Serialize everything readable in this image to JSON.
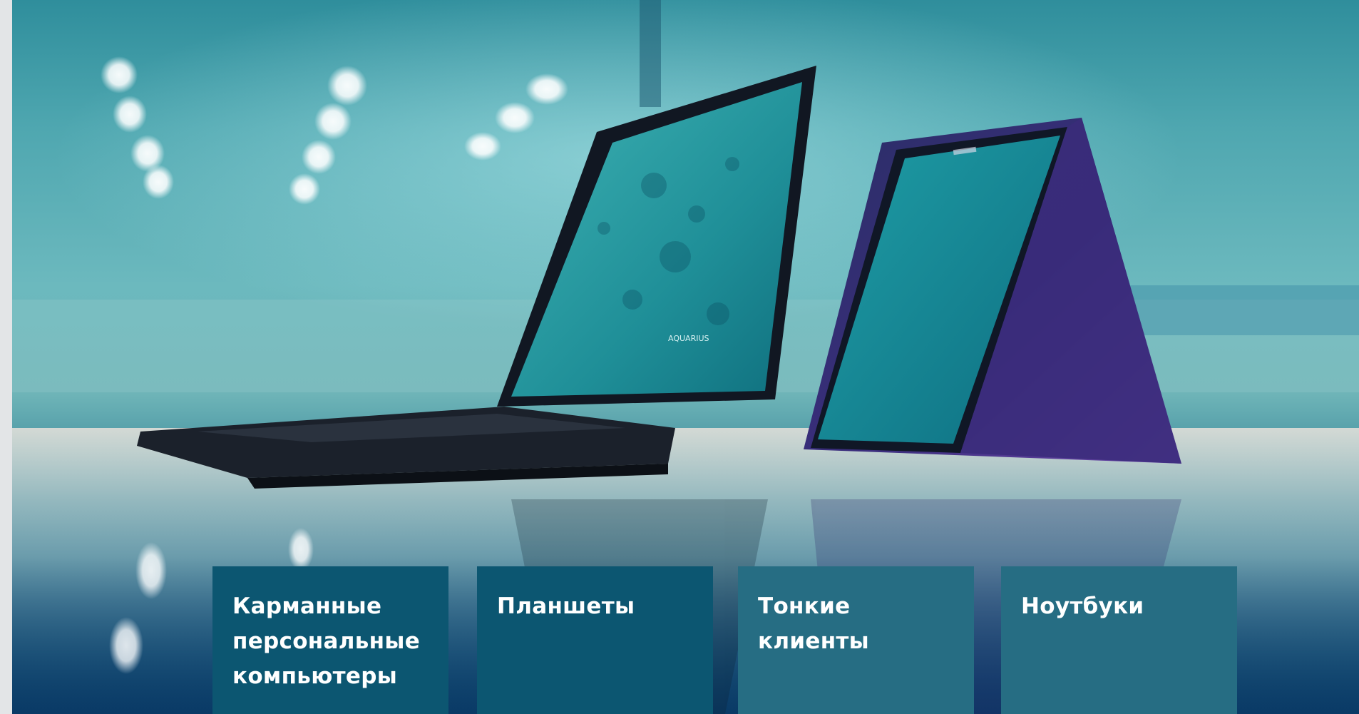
{
  "hero": {
    "image": "hero-laptops-photo",
    "screen_logo_text": "AQUARIUS"
  },
  "categories": [
    {
      "label": "Карманные персональные компьютеры",
      "color": "#0c5671"
    },
    {
      "label": "Планшеты",
      "color": "#0c5671"
    },
    {
      "label": "Тонкие клиенты",
      "color": "#266d83"
    },
    {
      "label": "Ноутбуки",
      "color": "#266d83"
    }
  ]
}
